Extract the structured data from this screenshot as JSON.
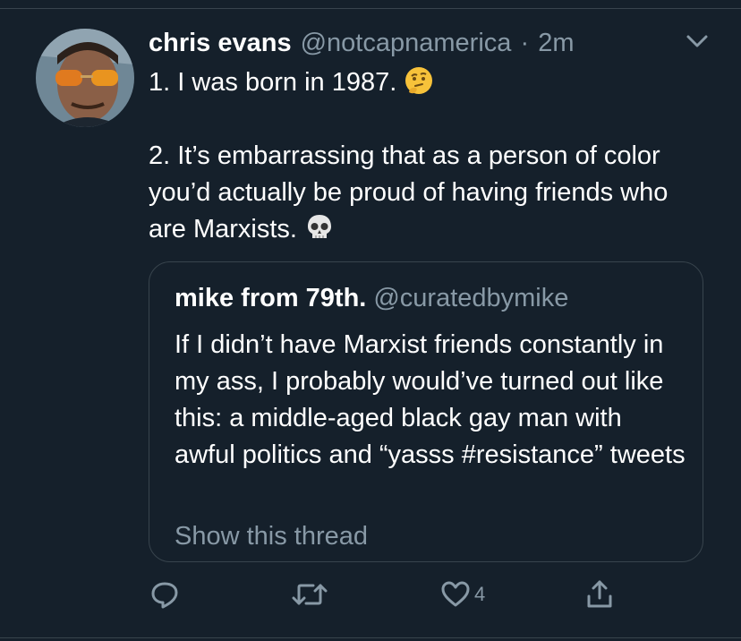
{
  "tweet": {
    "display_name": "chris evans",
    "handle": "@notcapnamerica",
    "separator": "·",
    "time": "2m",
    "paragraph_1": "1. I was born in 1987.",
    "paragraph_1_emoji": "thinking-face-emoji",
    "paragraph_2": "2. It’s embarrassing that as a person of color you’d actually be proud of having friends who are Marxists.",
    "paragraph_2_emoji": "skull-emoji"
  },
  "quote": {
    "display_name": "mike from 79th.",
    "handle": "@curatedbymike",
    "text": "If I didn’t have Marxist friends constantly in my ass, I probably would’ve turned out like this: a middle-aged black gay man with awful politics and “yasss #resistance” tweets",
    "show_thread": "Show this thread"
  },
  "actions": {
    "reply_icon": "reply-icon",
    "retweet_icon": "retweet-icon",
    "like_icon": "heart-icon",
    "like_count": "4",
    "share_icon": "share-icon"
  },
  "colors": {
    "background": "#15202b",
    "text_primary": "#ffffff",
    "text_secondary": "#8899a6",
    "border": "#38444d",
    "emoji_yellow": "#f7c23a"
  }
}
